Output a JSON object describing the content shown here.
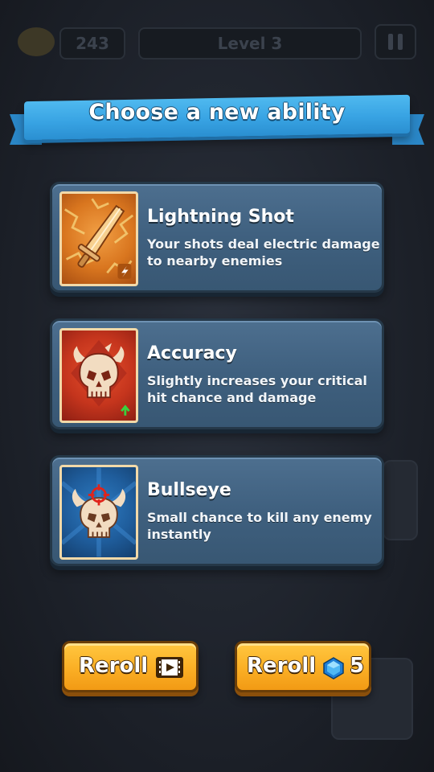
{
  "hud": {
    "coins": "243",
    "level": "Level 3"
  },
  "banner": {
    "title": "Choose a new ability"
  },
  "abilities": [
    {
      "name": "Lightning Shot",
      "description": "Your shots deal electric damage to nearby enemies",
      "icon": "lightning-sword-icon",
      "icon_color": "#d9761f"
    },
    {
      "name": "Accuracy",
      "description": "Slightly increases your critical hit chance and damage",
      "icon": "skull-upgrade-icon",
      "icon_color": "#c5351d"
    },
    {
      "name": "Bullseye",
      "description": "Small chance to kill any enemy instantly",
      "icon": "skull-crosshair-icon",
      "icon_color": "#1f5d9c"
    }
  ],
  "buttons": {
    "reroll_video_label": "Reroll",
    "reroll_gem_label": "Reroll",
    "reroll_gem_cost": "5"
  },
  "colors": {
    "banner": "#38a3e3",
    "card": "#3f607f",
    "button": "#fbb127"
  }
}
